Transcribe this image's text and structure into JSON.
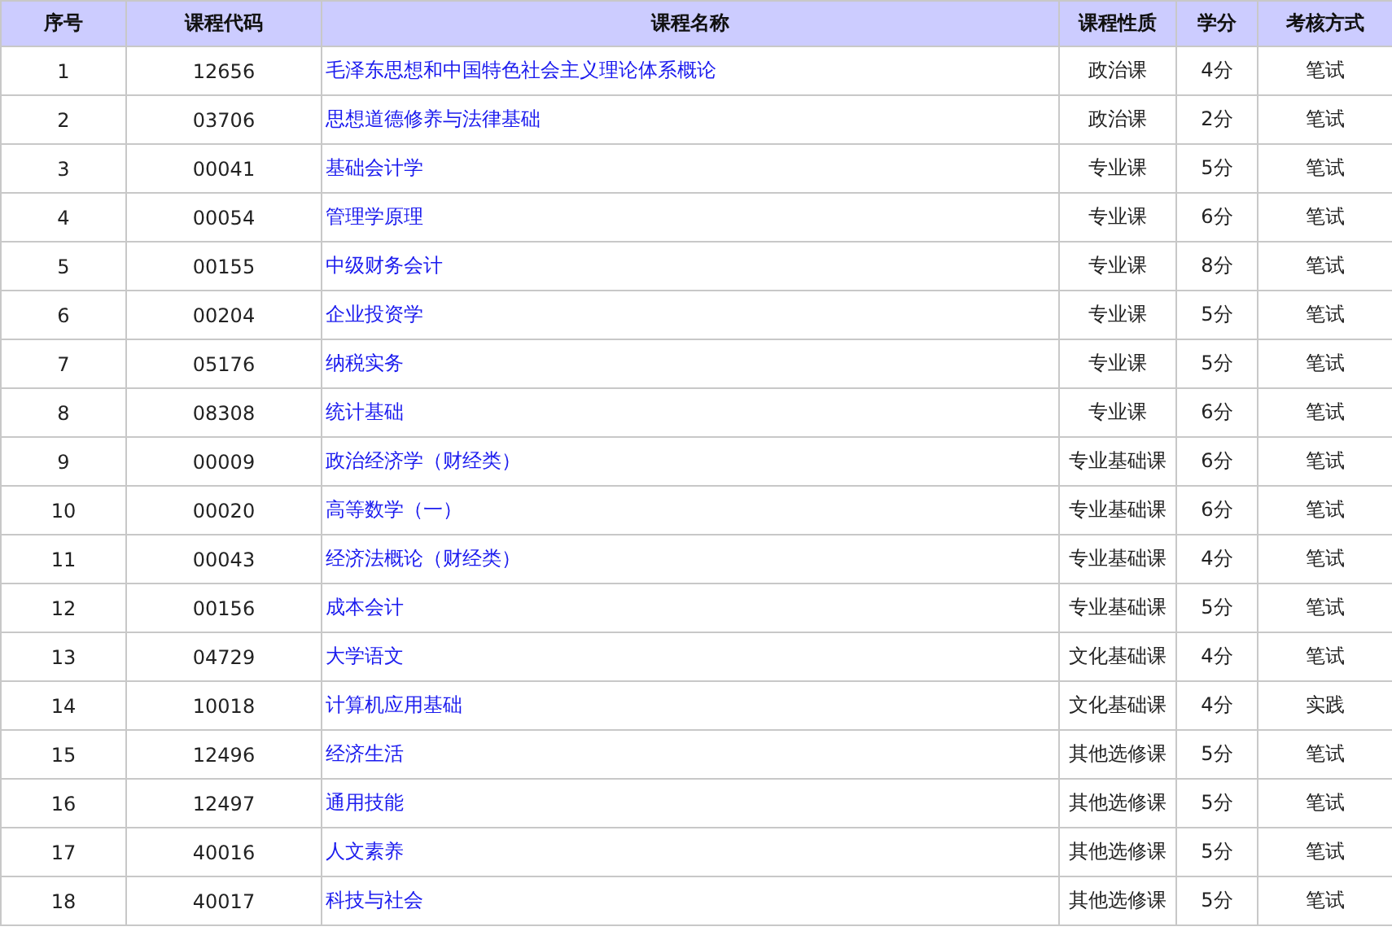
{
  "table": {
    "columns": [
      "序号",
      "课程代码",
      "课程名称",
      "课程性质",
      "学分",
      "考核方式"
    ],
    "rows": [
      [
        "1",
        "12656",
        "毛泽东思想和中国特色社会主义理论体系概论",
        "政治课",
        "4分",
        "笔试"
      ],
      [
        "2",
        "03706",
        "思想道德修养与法律基础",
        "政治课",
        "2分",
        "笔试"
      ],
      [
        "3",
        "00041",
        "基础会计学",
        "专业课",
        "5分",
        "笔试"
      ],
      [
        "4",
        "00054",
        "管理学原理",
        "专业课",
        "6分",
        "笔试"
      ],
      [
        "5",
        "00155",
        "中级财务会计",
        "专业课",
        "8分",
        "笔试"
      ],
      [
        "6",
        "00204",
        "企业投资学",
        "专业课",
        "5分",
        "笔试"
      ],
      [
        "7",
        "05176",
        "纳税实务",
        "专业课",
        "5分",
        "笔试"
      ],
      [
        "8",
        "08308",
        "统计基础",
        "专业课",
        "6分",
        "笔试"
      ],
      [
        "9",
        "00009",
        "政治经济学（财经类）",
        "专业基础课",
        "6分",
        "笔试"
      ],
      [
        "10",
        "00020",
        "高等数学（一）",
        "专业基础课",
        "6分",
        "笔试"
      ],
      [
        "11",
        "00043",
        "经济法概论（财经类）",
        "专业基础课",
        "4分",
        "笔试"
      ],
      [
        "12",
        "00156",
        "成本会计",
        "专业基础课",
        "5分",
        "笔试"
      ],
      [
        "13",
        "04729",
        "大学语文",
        "文化基础课",
        "4分",
        "笔试"
      ],
      [
        "14",
        "10018",
        "计算机应用基础",
        "文化基础课",
        "4分",
        "实践"
      ],
      [
        "15",
        "12496",
        "经济生活",
        "其他选修课",
        "5分",
        "笔试"
      ],
      [
        "16",
        "12497",
        "通用技能",
        "其他选修课",
        "5分",
        "笔试"
      ],
      [
        "17",
        "40016",
        "人文素养",
        "其他选修课",
        "5分",
        "笔试"
      ],
      [
        "18",
        "40017",
        "科技与社会",
        "其他选修课",
        "5分",
        "笔试"
      ]
    ]
  }
}
